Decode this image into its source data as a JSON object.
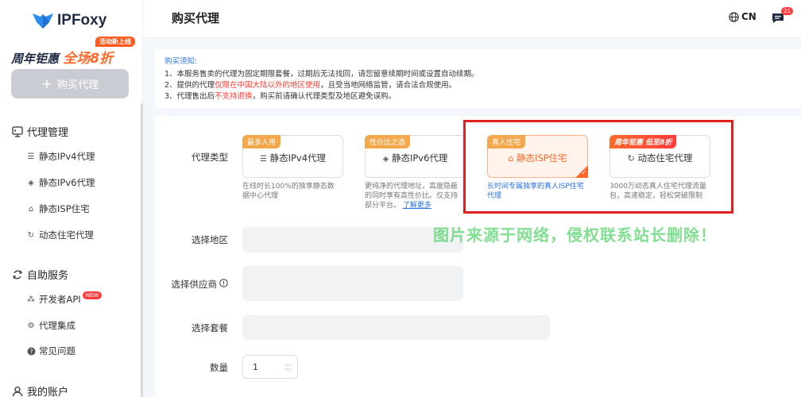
{
  "brand": {
    "name": "IPFoxy"
  },
  "promo": {
    "tag": "活动新上线",
    "text_a": "周年钜惠",
    "text_b": "全场8折"
  },
  "sidebar": {
    "buy_button": "购买代理",
    "groups": [
      {
        "label": "代理管理",
        "items": [
          "静态IPv4代理",
          "静态IPv6代理",
          "静态ISP住宅",
          "动态住宅代理"
        ]
      },
      {
        "label": "自助服务",
        "items": [
          "开发者API",
          "代理集成",
          "常见问题"
        ]
      },
      {
        "label": "我的账户"
      }
    ],
    "new_badge": "NEW"
  },
  "header": {
    "title": "购买代理",
    "lang": "CN",
    "msg_count": "21"
  },
  "notice": {
    "title": "购买须知:",
    "line1": "1、本服务售卖的代理为固定期限套餐，过期后无法找回，请您留意续期时间或设置自动续期。",
    "line2_a": "2、提供的代理",
    "line2_red": "仅限在中国大陆以外的地区使用",
    "line2_b": "，且受当地网络监管，请合法合规使用。",
    "line3_a": "3、代理售出后",
    "line3_red": "不支持退换",
    "line3_b": "，购买前请确认代理类型及地区避免误购。"
  },
  "form": {
    "proxy_type_label": "代理类型",
    "region_label": "选择地区",
    "provider_label": "选择供应商",
    "package_label": "选择套餐",
    "quantity_label": "数量",
    "quantity_value": "1",
    "cards": [
      {
        "tag": "最多人用",
        "title": "静态IPv4代理",
        "desc": "在线时长100%的独享静态数据中心代理"
      },
      {
        "tag": "性价比之选",
        "title": "静态IPv6代理",
        "desc": "更纯净的代理地址，高度隐蔽的同时享有高性价比。仅支持部分平台。",
        "link": "了解更多"
      },
      {
        "tag": "真人住宅",
        "title": "静态ISP住宅",
        "desc": "长时间专属独享的真人ISP住宅代理"
      },
      {
        "tag": "周年钜惠 低至8折",
        "title": "动态住宅代理",
        "desc": "3000万动态真人住宅代理流量包，高速稳定，轻松突破限制"
      }
    ]
  },
  "watermark": "图片来源于网络，侵权联系站长删除！"
}
